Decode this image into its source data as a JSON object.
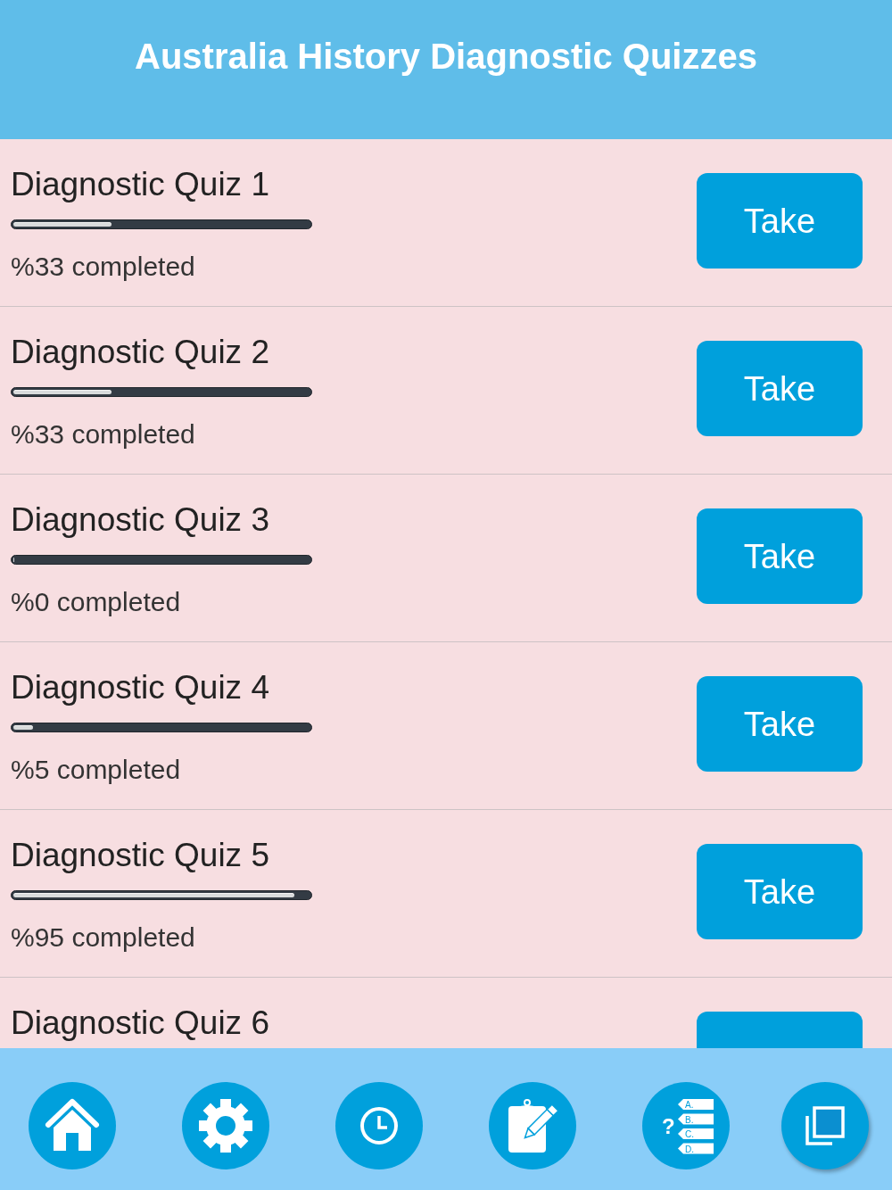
{
  "header": {
    "title": "Australia History Diagnostic Quizzes"
  },
  "quizzes": [
    {
      "kind": "full",
      "title": "Diagnostic Quiz 1",
      "level": 0.33,
      "progress": "%33 completed",
      "button": "Take"
    },
    {
      "kind": "full",
      "title": "Diagnostic Quiz 2",
      "level": 0.33,
      "progress": "%33 completed",
      "button": "Take"
    },
    {
      "kind": "full",
      "title": "Diagnostic Quiz 3",
      "level": 0,
      "progress": "%0 completed",
      "button": "Take"
    },
    {
      "kind": "full",
      "title": "Diagnostic Quiz 4",
      "level": 0.05,
      "progress": "%5 completed",
      "button": "Take"
    },
    {
      "kind": "full",
      "title": "Diagnostic Quiz 5",
      "level": 0.95,
      "progress": "%95 completed",
      "button": "Take"
    },
    {
      "kind": "cut_off",
      "title": "Diagnostic Quiz 6"
    }
  ],
  "tab_bar": {
    "buttons": [
      {
        "kind": "home"
      },
      {
        "kind": "settings"
      },
      {
        "kind": "clock"
      },
      {
        "kind": "notes"
      },
      {
        "kind": "quiz",
        "mark": "?",
        "options": [
          "A.",
          "B.",
          "C.",
          "D."
        ]
      },
      {
        "kind": "copy"
      }
    ]
  }
}
